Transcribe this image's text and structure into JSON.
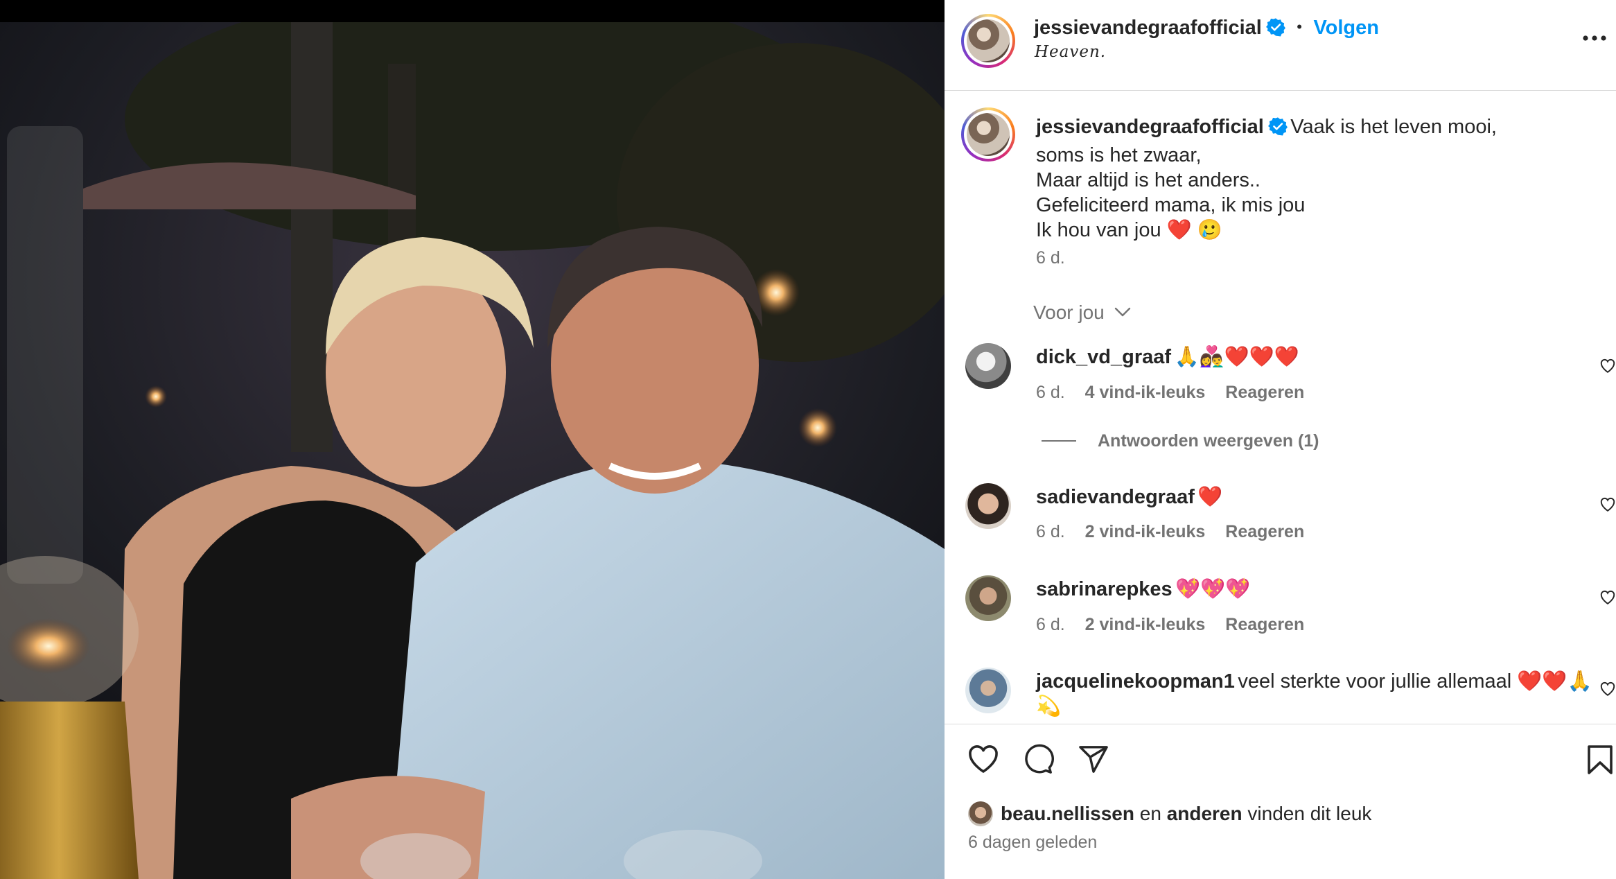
{
  "post": {
    "author": "jessievandegraafofficial",
    "follow_label": "Volgen",
    "separator": "•",
    "location": "Heaven.",
    "more_icon": "more-horizontal-icon"
  },
  "caption": {
    "author": "jessievandegraafofficial",
    "lines": [
      "Vaak is het leven mooi,",
      "soms is het zwaar,",
      "Maar altijd is het anders..",
      "Gefeliciteerd mama, ik mis jou",
      "Ik hou van jou ❤️ 🥲"
    ],
    "time": "6 d."
  },
  "filter": {
    "label": "Voor jou",
    "icon": "chevron-down-icon"
  },
  "comments": [
    {
      "user": "dick_vd_graaf",
      "text": "🙏👩‍❤️‍👨❤️❤️❤️",
      "time": "6 d.",
      "likes": "4 vind-ik-leuks",
      "reply": "Reageren",
      "view_replies": "Antwoorden weergeven (1)"
    },
    {
      "user": "sadievandegraaf",
      "text": "❤️",
      "time": "6 d.",
      "likes": "2 vind-ik-leuks",
      "reply": "Reageren"
    },
    {
      "user": "sabrinarepkes",
      "text": "💖💖💖",
      "time": "6 d.",
      "likes": "2 vind-ik-leuks",
      "reply": "Reageren"
    },
    {
      "user": "jacquelinekoopman1",
      "text": "veel sterkte voor jullie allemaal ❤️❤️🙏",
      "text2": "💫"
    }
  ],
  "actions": {
    "like_icon": "heart-outline-icon",
    "comment_icon": "comment-icon",
    "share_icon": "send-icon",
    "save_icon": "bookmark-icon"
  },
  "likes": {
    "user": "beau.nellissen",
    "connector": "en",
    "others": "anderen",
    "suffix": "vinden dit leuk",
    "date": "6 dagen geleden"
  },
  "colors": {
    "link_blue": "#0095f6",
    "verified_blue": "#0095f6",
    "secondary_text": "#737373",
    "heart_red": "#ed4956"
  }
}
